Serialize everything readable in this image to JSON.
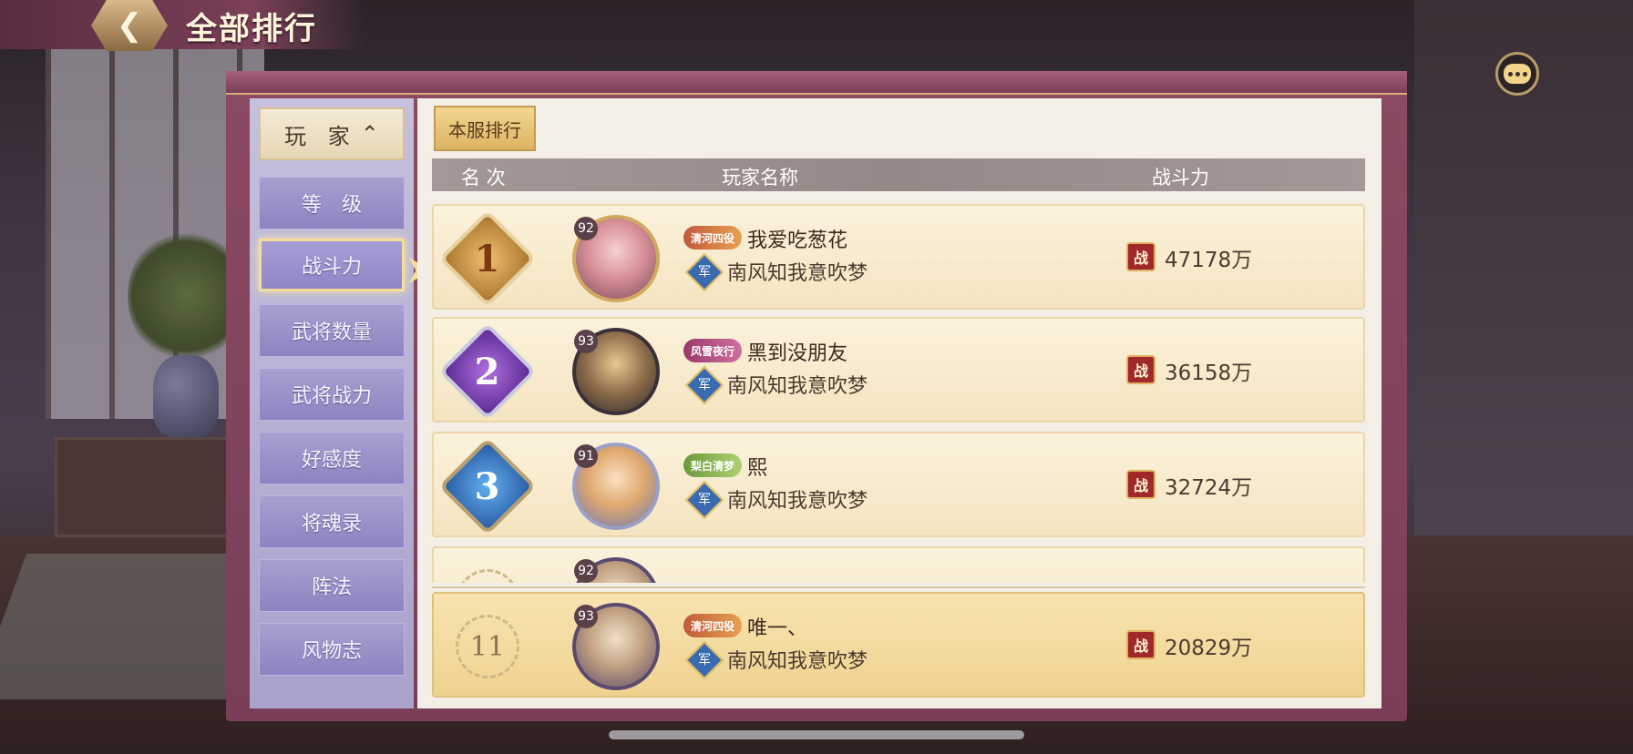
{
  "header": {
    "title": "全部排行",
    "back_icon": "arrow-left-icon"
  },
  "chat_icon": "chat-bubble-icon",
  "sidebar": {
    "items": [
      {
        "label": "玩 家"
      },
      {
        "label": "等　级"
      },
      {
        "label": "战斗力"
      },
      {
        "label": "武将数量"
      },
      {
        "label": "武将战力"
      },
      {
        "label": "好感度"
      },
      {
        "label": "将魂录"
      },
      {
        "label": "阵法"
      },
      {
        "label": "风物志"
      }
    ],
    "active_index": 2
  },
  "tab": {
    "label": "本服排行"
  },
  "columns": {
    "rank": "名 次",
    "name": "玩家名称",
    "power": "战斗力"
  },
  "colors": {
    "accent": "#f4de9a",
    "panel": "#7a3e58",
    "sidebar": "#a9a2cc"
  },
  "rows": [
    {
      "rank": "1",
      "level": "92",
      "title_badge": "清河四役",
      "name": "我爱吃葱花",
      "guild_icon": "军",
      "guild": "南风知我意吹梦",
      "power_icon": "战",
      "power": "47178万"
    },
    {
      "rank": "2",
      "level": "93",
      "title_badge": "风雪夜行",
      "name": "黑到没朋友",
      "guild_icon": "军",
      "guild": "南风知我意吹梦",
      "power_icon": "战",
      "power": "36158万"
    },
    {
      "rank": "3",
      "level": "91",
      "title_badge": "梨白清梦",
      "name": "熙",
      "guild_icon": "军",
      "guild": "南风知我意吹梦",
      "power_icon": "战",
      "power": "32724万"
    },
    {
      "rank": "",
      "level": "92",
      "title_badge": "",
      "name": "",
      "guild_icon": "",
      "guild": "",
      "power_icon": "",
      "power": ""
    }
  ],
  "self": {
    "rank": "11",
    "level": "93",
    "title_badge": "清河四役",
    "name": "唯一、",
    "guild_icon": "军",
    "guild": "南风知我意吹梦",
    "power_icon": "战",
    "power": "20829万"
  }
}
